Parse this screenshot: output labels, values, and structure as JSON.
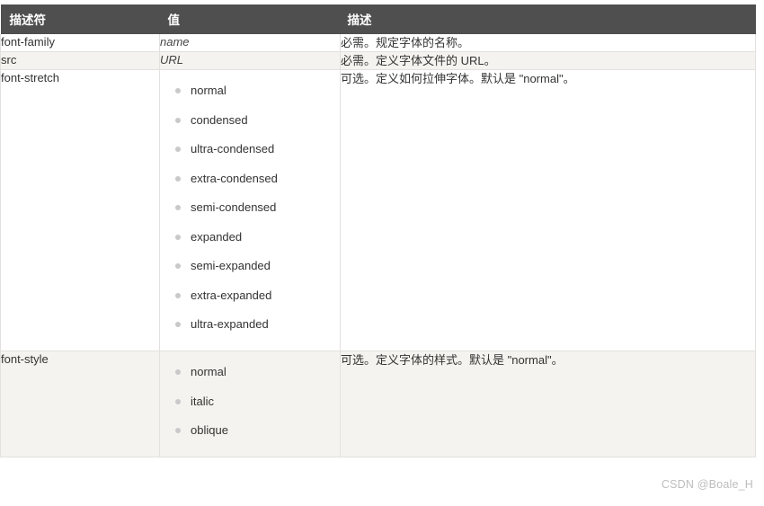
{
  "table": {
    "headers": {
      "descriptor": "描述符",
      "value": "值",
      "description": "描述"
    },
    "rows": [
      {
        "name": "font-family",
        "value_text": "name",
        "description": "必需。规定字体的名称。"
      },
      {
        "name": "src",
        "value_text": "URL",
        "description": "必需。定义字体文件的 URL。"
      },
      {
        "name": "font-stretch",
        "values": [
          "normal",
          "condensed",
          "ultra-condensed",
          "extra-condensed",
          "semi-condensed",
          "expanded",
          "semi-expanded",
          "extra-expanded",
          "ultra-expanded"
        ],
        "description": "可选。定义如何拉伸字体。默认是 \"normal\"。"
      },
      {
        "name": "font-style",
        "values": [
          "normal",
          "italic",
          "oblique"
        ],
        "description": "可选。定义字体的样式。默认是 \"normal\"。"
      }
    ]
  },
  "watermark": "CSDN @Boale_H",
  "colors": {
    "header_bg": "#4f4f4f",
    "header_text": "#ffffff",
    "row_alt_bg": "#f4f3ef",
    "border": "#e3e1dd",
    "bullet": "#c9c9c9",
    "text": "#333333",
    "watermark": "#bdbdbd"
  }
}
